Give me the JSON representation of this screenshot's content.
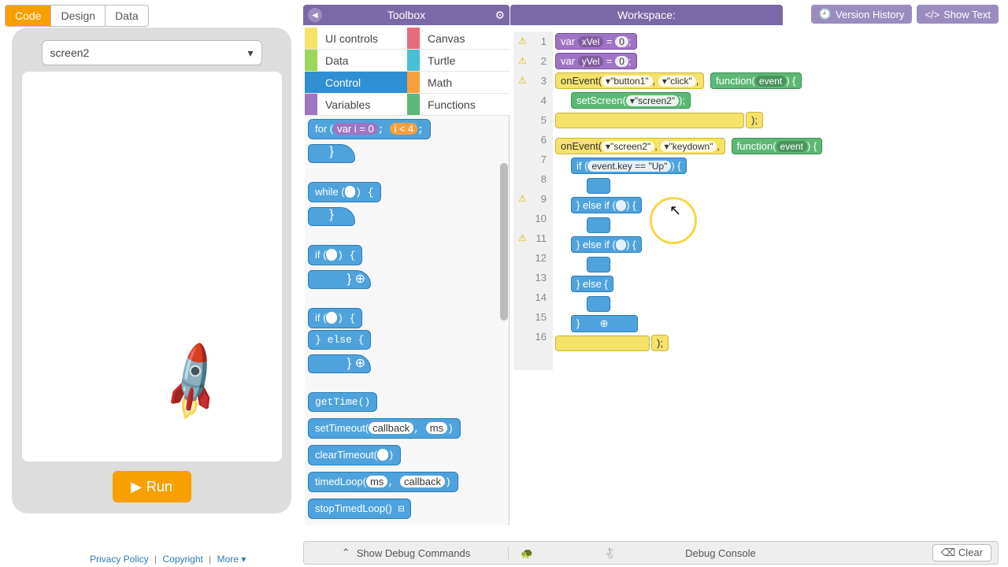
{
  "tabs": {
    "code": "Code",
    "design": "Design",
    "data": "Data"
  },
  "screen_select": "screen2",
  "run": "Run",
  "toolbox_title": "Toolbox",
  "workspace_title": "Workspace:",
  "btn_history": "Version History",
  "btn_showtext": "Show Text",
  "categories": {
    "ui": "UI controls",
    "canvas": "Canvas",
    "data": "Data",
    "turtle": "Turtle",
    "control": "Control",
    "math": "Math",
    "variables": "Variables",
    "functions": "Functions"
  },
  "blocks": {
    "for": "for (",
    "for_var": "var i = 0",
    "for_cond": "i < 4",
    "while": "while (",
    "if": "if (",
    "else": "} else {",
    "gettime": "getTime()",
    "settimeout": "setTimeout(",
    "callback": "callback",
    "ms": "ms",
    "cleartimeout": "clearTimeout(",
    "timedloop": "timedLoop(",
    "stoptimed": "stopTimedLoop()"
  },
  "code": {
    "var": "var",
    "xvel": "xVel",
    "yvel": "yVel",
    "eq0": " = ",
    "zero": "0",
    "semi": ";",
    "onevent": "onEvent(",
    "btn1": "▾\"button1\"",
    "click": "▾\"click\"",
    "comma": ",",
    "func": "function(",
    "event": "event",
    "brace": ") {",
    "setscreen": "setScreen(",
    "scr2": "▾\"screen2\"",
    "close": ");",
    "screen2": "▾\"screen2\"",
    "keydown": "▾\"keydown\"",
    "if": "if (",
    "cond": "event.key == \"Up\"",
    "ob": ") {",
    "elseif": "} else if (",
    "empty": " ",
    "else": "} else {",
    "cb": "}"
  },
  "lines": [
    "1",
    "2",
    "3",
    "4",
    "5",
    "6",
    "7",
    "8",
    "9",
    "10",
    "11",
    "12",
    "13",
    "14",
    "15",
    "16"
  ],
  "debug_left": "Show Debug Commands",
  "debug_right": "Debug Console",
  "clear": "Clear",
  "footer": {
    "privacy": "Privacy Policy",
    "copyright": "Copyright",
    "more": "More ▾"
  }
}
